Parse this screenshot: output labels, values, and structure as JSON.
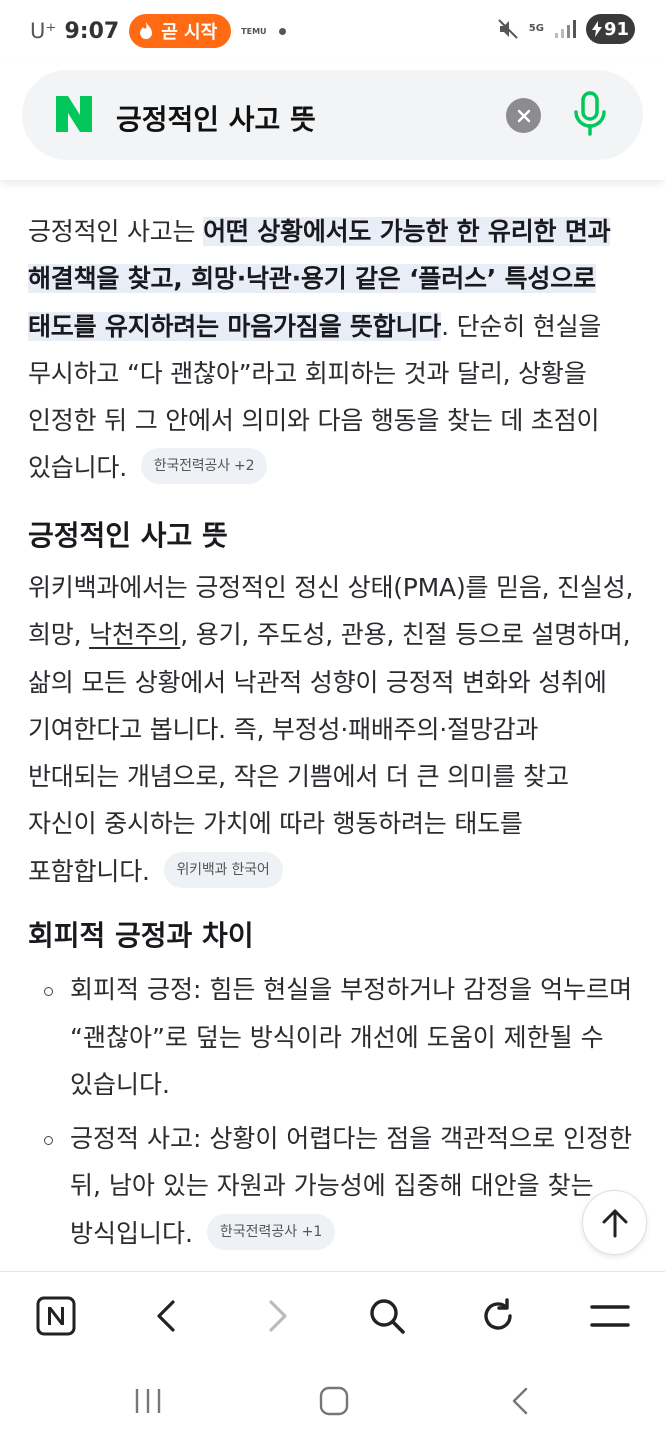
{
  "status_bar": {
    "carrier": "U⁺",
    "time": "9:07",
    "live_chip": "곧 시작",
    "temu_logo": "TEMU",
    "network": "5G",
    "battery": "91"
  },
  "search": {
    "query": "긍정적인 사고 뜻",
    "logo": "N",
    "icons": {
      "clear": "clear-icon",
      "mic": "mic-icon"
    },
    "brand_color": "#03c75a"
  },
  "intro": {
    "lead": "긍정적인 사고는 ",
    "highlight": "어떤 상황에서도 가능한 한 유리한 면과 해결책을 찾고, 희망·낙관·용기 같은 ‘플러스’ 특성으로 태도를 유지하려는 마음가짐을 뜻합니다",
    "rest": ". 단순히 현실을 무시하고 “다 괜찮아”라고 회피하는 것과 달리, 상황을 인정한 뒤 그 안에서 의미와 다음 행동을 찾는 데 초점이 있습니다.",
    "citation": "한국전력공사 +2"
  },
  "section1": {
    "heading": "긍정적인 사고 뜻",
    "text_before": "위키백과에서는 긍정적인 정신 상태(PMA)를 믿음, 진실성, 희망, ",
    "link": "낙천주의",
    "text_after": ", 용기, 주도성, 관용, 친절 등으로 설명하며, 삶의 모든 상황에서 낙관적 성향이 긍정적 변화와 성취에 기여한다고 봅니다. 즉, 부정성·패배주의·절망감과 반대되는 개념으로, 작은 기쁨에서 더 큰 의미를 찾고 자신이 중시하는 가치에 따라 행동하려는 태도를 포함합니다.",
    "citation": "위키백과 한국어"
  },
  "section2": {
    "heading": "회피적 긍정과 차이",
    "bullets": [
      {
        "text": "회피적 긍정: 힘든 현실을 부정하거나 감정을 억누르며 “괜찮아”로 덮는 방식이라 개선에 도움이 제한될 수 있습니다."
      },
      {
        "text": "긍정적 사고: 상황이 어렵다는 점을 객관적으로 인정한 뒤, 남아 있는 자원과 가능성에 집중해 대안을 찾는 방식입니다.",
        "citation": "한국전력공사 +1"
      }
    ]
  },
  "toolbar": {
    "items": [
      "naver-home-icon",
      "back-icon",
      "forward-icon",
      "search-icon",
      "refresh-icon",
      "menu-icon"
    ]
  },
  "system_nav": {
    "items": [
      "recent-apps-icon",
      "home-icon",
      "system-back-icon"
    ]
  }
}
